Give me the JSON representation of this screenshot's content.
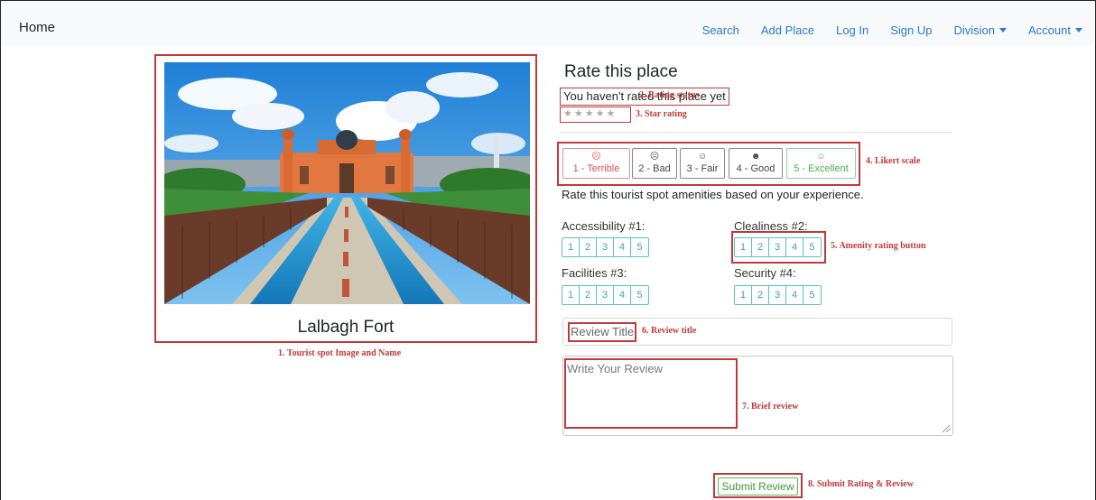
{
  "navbar": {
    "brand": "Home",
    "links": [
      "Search",
      "Add Place",
      "Log In",
      "Sign Up"
    ],
    "division": "Division",
    "account": "Account"
  },
  "spot": {
    "name": "Lalbagh Fort",
    "caption": "1. Tourist spot Image and Name"
  },
  "rating": {
    "title": "Rate this place",
    "status": "You haven't rated this place yet",
    "status_caption": "2. Rating status",
    "stars": "★★★★★",
    "stars_caption": "3. Star rating"
  },
  "likert": {
    "caption": "4. Likert scale",
    "options": [
      {
        "face": "☹",
        "label": "1 - Terrible"
      },
      {
        "face": "☹",
        "label": "2 - Bad"
      },
      {
        "face": "☺",
        "label": "3 - Fair"
      },
      {
        "face": "☻",
        "label": "4 - Good"
      },
      {
        "face": "☺",
        "label": "5 - Excellent"
      }
    ]
  },
  "amenities": {
    "intro": "Rate this tourist spot amenities based on your experience.",
    "caption": "5. Amenity rating button",
    "items": [
      {
        "label": "Accessibility #1:"
      },
      {
        "label": "Clealiness #2:"
      },
      {
        "label": "Facilities #3:"
      },
      {
        "label": "Security #4:"
      }
    ],
    "scale": [
      "1",
      "2",
      "3",
      "4",
      "5"
    ]
  },
  "review": {
    "title_placeholder": "Review Title",
    "title_caption": "6. Review title",
    "body_placeholder": "Write Your Review",
    "body_caption": "7. Brief review"
  },
  "submit": {
    "label": "Submit Review",
    "caption": "8. Submit Rating & Review"
  },
  "colors": {
    "annotation": "#c0393b",
    "link": "#2a7ad0",
    "info": "#3aa5ab",
    "success": "#3d9a3d",
    "danger": "#d9534f"
  }
}
